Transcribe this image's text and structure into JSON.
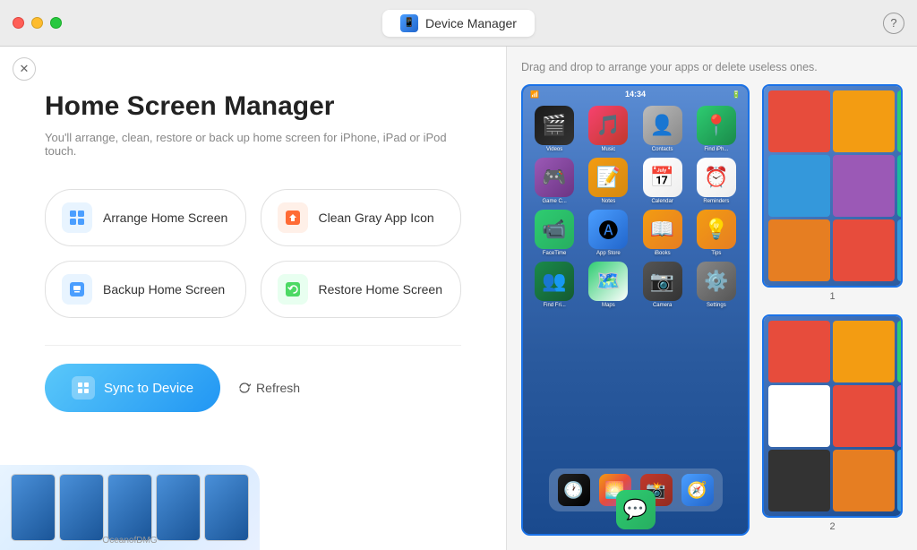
{
  "titleBar": {
    "title": "Device Manager",
    "helpLabel": "?",
    "closeLabel": "×"
  },
  "leftPanel": {
    "panelTitle": "Home Screen Manager",
    "panelSubtitle": "You'll arrange, clean, restore or back up home screen for iPhone, iPad or iPod touch.",
    "actions": [
      {
        "id": "arrange",
        "label": "Arrange Home Screen",
        "iconColor": "blue"
      },
      {
        "id": "clean",
        "label": "Clean Gray App Icon",
        "iconColor": "orange"
      },
      {
        "id": "backup",
        "label": "Backup Home Screen",
        "iconColor": "lblue"
      },
      {
        "id": "restore",
        "label": "Restore Home Screen",
        "iconColor": "green"
      }
    ],
    "syncButton": "Sync to Device",
    "refreshButton": "Refresh"
  },
  "rightPanel": {
    "dragHint": "Drag and drop to arrange your apps or delete useless ones.",
    "phoneTime": "14:34",
    "apps": [
      {
        "name": "Videos",
        "emoji": "🎬",
        "class": "app-videos"
      },
      {
        "name": "Music",
        "emoji": "🎵",
        "class": "app-music"
      },
      {
        "name": "Contacts",
        "emoji": "👤",
        "class": "app-contacts"
      },
      {
        "name": "Find iPh...",
        "emoji": "📍",
        "class": "app-findmy"
      },
      {
        "name": "Game C...",
        "emoji": "🎮",
        "class": "app-game"
      },
      {
        "name": "Notes",
        "emoji": "📝",
        "class": "app-notes"
      },
      {
        "name": "Calendar",
        "emoji": "📅",
        "class": "app-calendar"
      },
      {
        "name": "Reminders",
        "emoji": "⏰",
        "class": "app-reminders"
      },
      {
        "name": "FaceTime",
        "emoji": "📹",
        "class": "app-facetime"
      },
      {
        "name": "App Store",
        "emoji": "🅐",
        "class": "app-appstore"
      },
      {
        "name": "iBooks",
        "emoji": "📖",
        "class": "app-ibooks"
      },
      {
        "name": "Tips",
        "emoji": "💡",
        "class": "app-tips"
      },
      {
        "name": "Find Fri...",
        "emoji": "👥",
        "class": "app-findfriends"
      },
      {
        "name": "Maps",
        "emoji": "🗺️",
        "class": "app-maps"
      },
      {
        "name": "Camera",
        "emoji": "📷",
        "class": "app-camera"
      },
      {
        "name": "Settings",
        "emoji": "⚙️",
        "class": "app-settings"
      }
    ],
    "dockApps": [
      {
        "name": "Clock",
        "emoji": "🕐",
        "class": "app-clock"
      },
      {
        "name": "Photos",
        "emoji": "🌅",
        "class": "app-photos"
      },
      {
        "name": "PhotoBooth",
        "emoji": "📸",
        "class": "app-photobooth"
      },
      {
        "name": "Safari",
        "emoji": "🧭",
        "class": "app-safari"
      }
    ],
    "messageApp": {
      "name": "Messages",
      "emoji": "💬",
      "class": "app-messages"
    },
    "thumbLabels": [
      "1",
      "2"
    ]
  },
  "watermark": "OceanofDMG"
}
